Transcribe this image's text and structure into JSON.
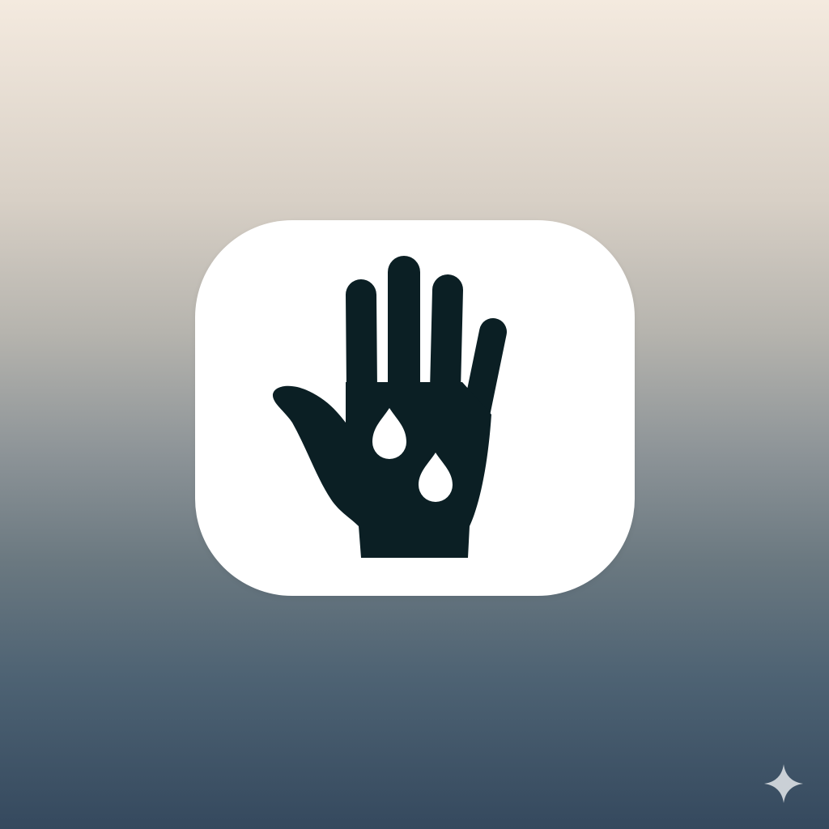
{
  "icons": {
    "main": "wet-hand-icon",
    "drops": "water-drop-icon",
    "corner": "sparkle-icon"
  },
  "colors": {
    "gradient_top": "#f4eadf",
    "gradient_bottom": "#35495e",
    "card_background": "#ffffff",
    "glyph": "#0b1f24",
    "sparkle": "#e3e6ea"
  }
}
